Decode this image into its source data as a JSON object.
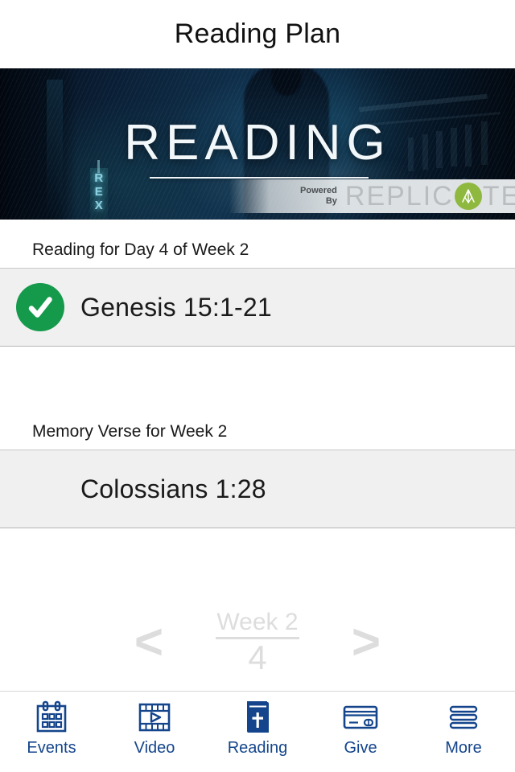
{
  "header": {
    "title": "Reading Plan"
  },
  "hero": {
    "wordmark": "READING",
    "neon_sign": [
      "R",
      "E",
      "X"
    ],
    "watermark": {
      "powered": "Powered",
      "by": "By",
      "brand_part1": "REPLIC",
      "brand_part2": "TE",
      "brand_dot_icon": "replicate-leaf-icon",
      "dot_color": "#8fb83f"
    }
  },
  "main": {
    "reading_section": {
      "label": "Reading for Day 4 of Week 2",
      "item": {
        "title": "Genesis 15:1-21",
        "completed": true,
        "check_icon": "check-circle-icon",
        "check_color": "#159a4c"
      }
    },
    "memory_section": {
      "label": "Memory Verse for Week 2",
      "item": {
        "title": "Colossians 1:28"
      }
    },
    "week_nav": {
      "prev_icon": "chevron-left-icon",
      "prev_label": "<",
      "next_icon": "chevron-right-icon",
      "next_label": ">",
      "week_label": "Week 2",
      "day_label": "4",
      "color": "#dddddd"
    }
  },
  "tabbar": {
    "accent_color": "#14458c",
    "items": [
      {
        "label": "Events",
        "icon": "calendar-icon",
        "active": false
      },
      {
        "label": "Video",
        "icon": "film-play-icon",
        "active": false
      },
      {
        "label": "Reading",
        "icon": "bible-book-icon",
        "active": true
      },
      {
        "label": "Give",
        "icon": "credit-card-icon",
        "active": false
      },
      {
        "label": "More",
        "icon": "hamburger-icon",
        "active": false
      }
    ]
  }
}
